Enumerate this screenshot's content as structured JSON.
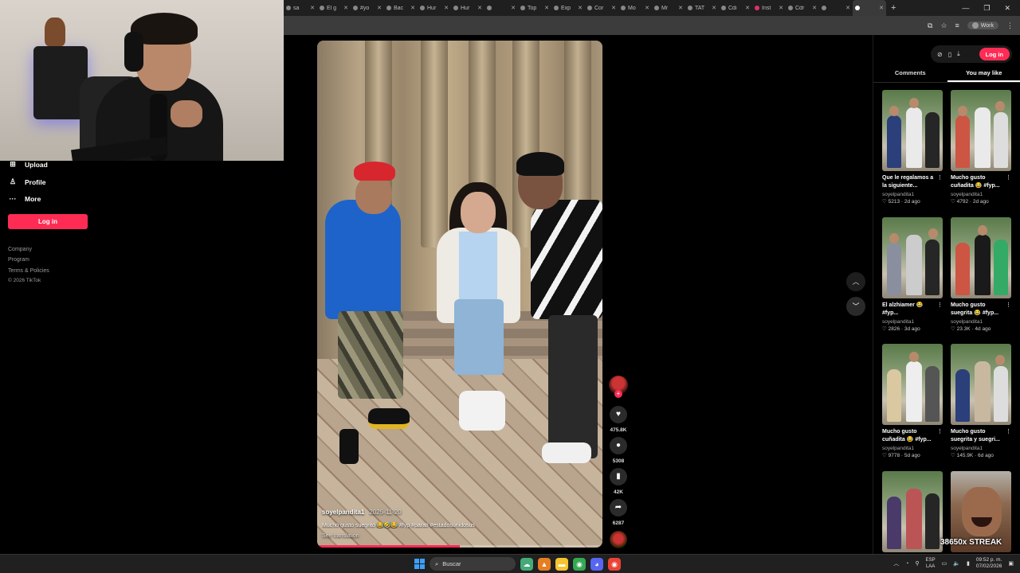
{
  "browser": {
    "tabs": [
      {
        "label": "sa"
      },
      {
        "label": "El g"
      },
      {
        "label": "#yo"
      },
      {
        "label": "Bac"
      },
      {
        "label": "Hur"
      },
      {
        "label": "Hur"
      },
      {
        "label": ""
      },
      {
        "label": "Top"
      },
      {
        "label": "Exp"
      },
      {
        "label": "Cor"
      },
      {
        "label": "Mo"
      },
      {
        "label": "Mr"
      },
      {
        "label": "TAT"
      },
      {
        "label": "Cdi"
      },
      {
        "label": "Inst"
      },
      {
        "label": "Cdr"
      },
      {
        "label": ""
      },
      {
        "label": ""
      }
    ],
    "profile_label": "Work"
  },
  "sidebar": {
    "items": [
      {
        "label": "Upload",
        "icon": "upload-icon"
      },
      {
        "label": "Profile",
        "icon": "person-icon"
      },
      {
        "label": "More",
        "icon": "more-icon"
      }
    ],
    "login_label": "Log in",
    "footer": [
      "Company",
      "Program",
      "Terms & Policies",
      "© 2026 TikTok"
    ]
  },
  "video": {
    "author": "soyelpandita1",
    "date": "2025-11-20",
    "caption": "Mucho gusto suegrito 😂🤣😂 #fyp #parati #estadosunidosus",
    "translation_label": "See translation",
    "progress": 0.5
  },
  "actions": {
    "likes": "475.8K",
    "comments": "5308",
    "saves": "42K",
    "shares": "6287"
  },
  "right_panel": {
    "login_label": "Log in",
    "tabs": [
      "Comments",
      "You may like"
    ],
    "active_tab": "You may like",
    "cards": [
      {
        "title": "Que le regalamos a la siguiente...",
        "author": "soyelpandita1",
        "likes": "5213",
        "age": "2d ago"
      },
      {
        "title": "Mucho gusto cuñadita 😂 #fyp...",
        "author": "soyelpandita1",
        "likes": "4792",
        "age": "2d ago"
      },
      {
        "title": "El alzhiamer 😂 #fyp...",
        "author": "soyelpandita1",
        "likes": "2826",
        "age": "3d ago"
      },
      {
        "title": "Mucho gusto suegrita 😂 #fyp...",
        "author": "soyelpandita1",
        "likes": "23.3K",
        "age": "4d ago"
      },
      {
        "title": "Mucho gusto cuñadita 😂 #fyp...",
        "author": "soyelpandita1",
        "likes": "9778",
        "age": "5d ago"
      },
      {
        "title": "Mucho gusto suegrita y suegri...",
        "author": "soyelpandita1",
        "likes": "145.9K",
        "age": "6d ago"
      }
    ],
    "streak_overlay": "38650x STREAK"
  },
  "taskbar": {
    "search_placeholder": "Buscar",
    "lang_top": "ESP",
    "lang_bottom": "LAA",
    "time": "09:52 p. m.",
    "date": "07/02/2026"
  },
  "colors": {
    "accent": "#fe2c55",
    "background": "#000000"
  }
}
